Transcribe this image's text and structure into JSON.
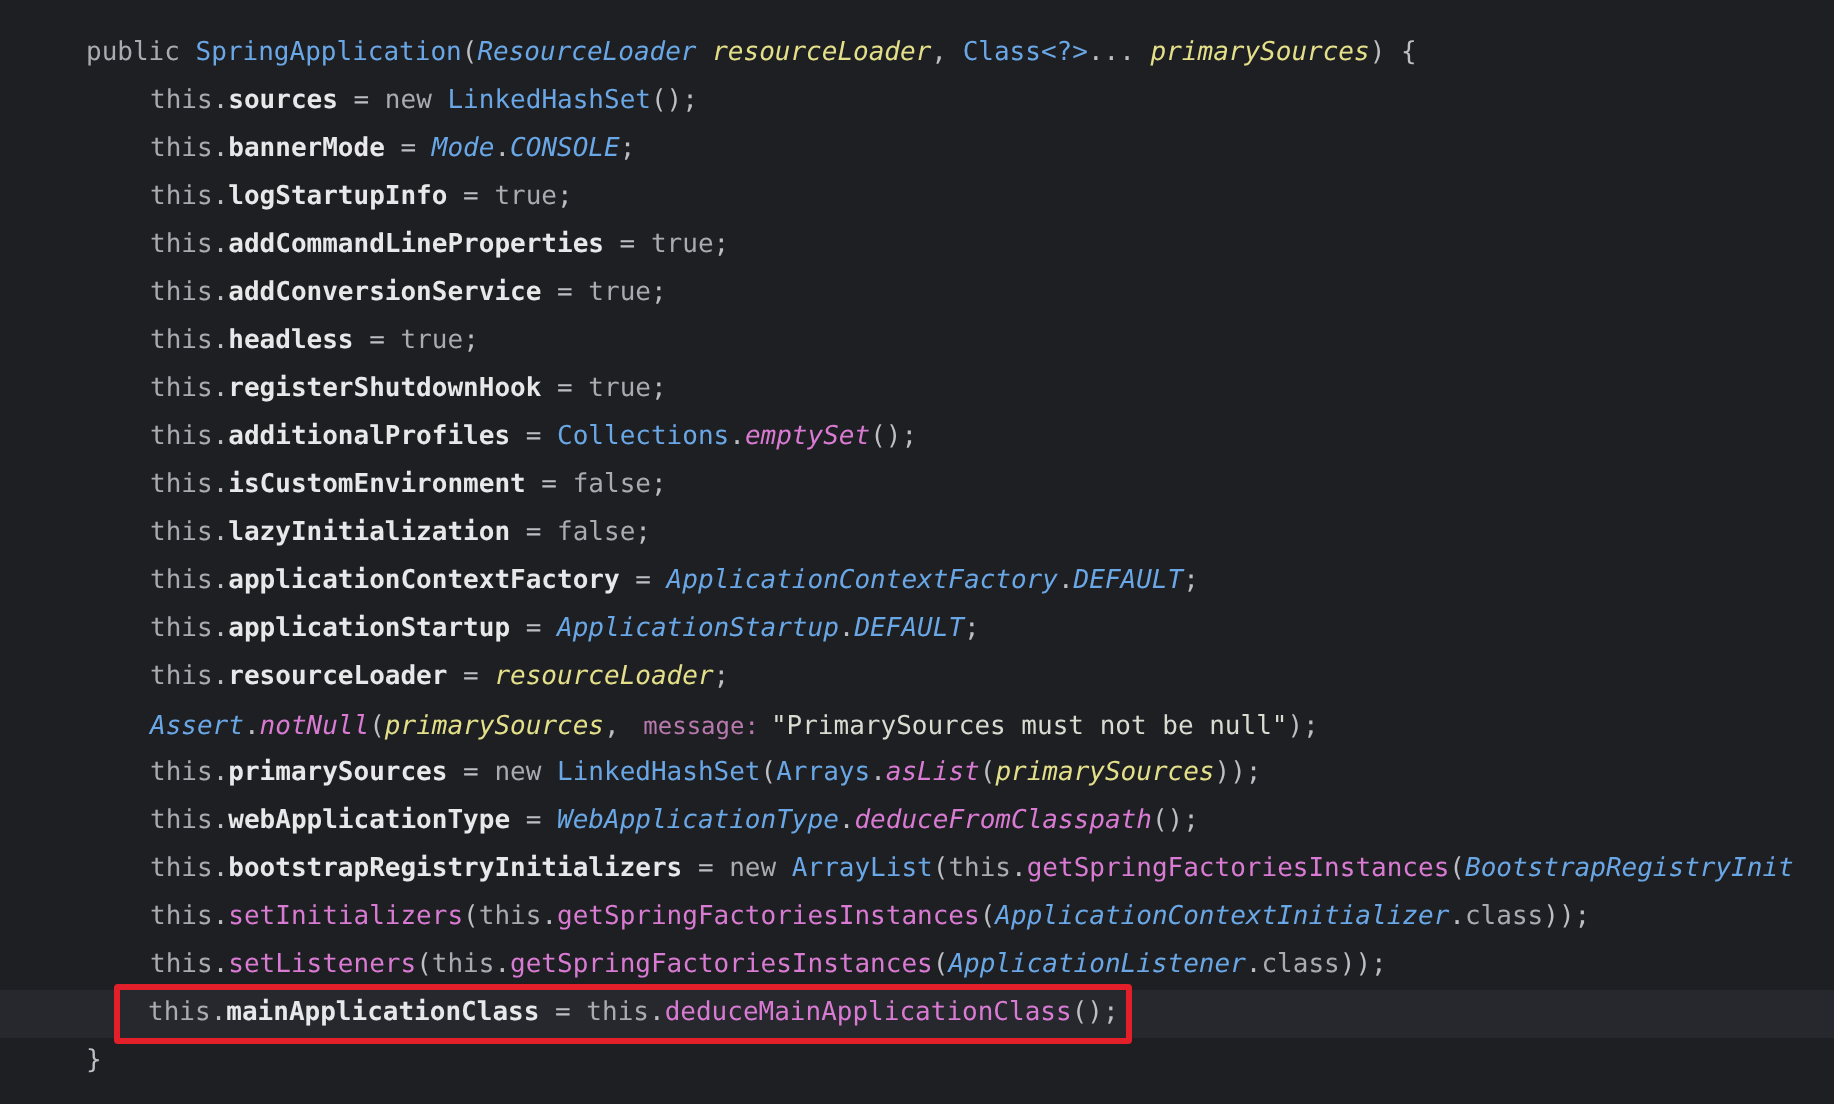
{
  "method": {
    "signature": [
      {
        "kind": "kw",
        "text": "public "
      },
      {
        "kind": "type",
        "text": "SpringApplication"
      },
      {
        "kind": "plain",
        "text": "("
      },
      {
        "kind": "itype",
        "text": "ResourceLoader "
      },
      {
        "kind": "param",
        "text": "resourceLoader"
      },
      {
        "kind": "plain",
        "text": ", "
      },
      {
        "kind": "type",
        "text": "Class<?>"
      },
      {
        "kind": "plain",
        "text": "... "
      },
      {
        "kind": "param",
        "text": "primarySources"
      },
      {
        "kind": "plain",
        "text": ") {"
      }
    ],
    "body": [
      {
        "current": false,
        "annotated": false,
        "tokens": [
          {
            "kind": "kw",
            "text": "this"
          },
          {
            "kind": "plain",
            "text": "."
          },
          {
            "kind": "field",
            "text": "sources"
          },
          {
            "kind": "plain",
            "text": " = "
          },
          {
            "kind": "kw",
            "text": "new "
          },
          {
            "kind": "type",
            "text": "LinkedHashSet"
          },
          {
            "kind": "plain",
            "text": "();"
          }
        ]
      },
      {
        "current": false,
        "annotated": false,
        "tokens": [
          {
            "kind": "kw",
            "text": "this"
          },
          {
            "kind": "plain",
            "text": "."
          },
          {
            "kind": "field",
            "text": "bannerMode"
          },
          {
            "kind": "plain",
            "text": " = "
          },
          {
            "kind": "itype",
            "text": "Mode"
          },
          {
            "kind": "plain",
            "text": "."
          },
          {
            "kind": "itype",
            "text": "CONSOLE"
          },
          {
            "kind": "plain",
            "text": ";"
          }
        ]
      },
      {
        "current": false,
        "annotated": false,
        "tokens": [
          {
            "kind": "kw",
            "text": "this"
          },
          {
            "kind": "plain",
            "text": "."
          },
          {
            "kind": "field",
            "text": "logStartupInfo"
          },
          {
            "kind": "plain",
            "text": " = "
          },
          {
            "kind": "kw",
            "text": "true"
          },
          {
            "kind": "plain",
            "text": ";"
          }
        ]
      },
      {
        "current": false,
        "annotated": false,
        "tokens": [
          {
            "kind": "kw",
            "text": "this"
          },
          {
            "kind": "plain",
            "text": "."
          },
          {
            "kind": "field",
            "text": "addCommandLineProperties"
          },
          {
            "kind": "plain",
            "text": " = "
          },
          {
            "kind": "kw",
            "text": "true"
          },
          {
            "kind": "plain",
            "text": ";"
          }
        ]
      },
      {
        "current": false,
        "annotated": false,
        "tokens": [
          {
            "kind": "kw",
            "text": "this"
          },
          {
            "kind": "plain",
            "text": "."
          },
          {
            "kind": "field",
            "text": "addConversionService"
          },
          {
            "kind": "plain",
            "text": " = "
          },
          {
            "kind": "kw",
            "text": "true"
          },
          {
            "kind": "plain",
            "text": ";"
          }
        ]
      },
      {
        "current": false,
        "annotated": false,
        "tokens": [
          {
            "kind": "kw",
            "text": "this"
          },
          {
            "kind": "plain",
            "text": "."
          },
          {
            "kind": "field",
            "text": "headless"
          },
          {
            "kind": "plain",
            "text": " = "
          },
          {
            "kind": "kw",
            "text": "true"
          },
          {
            "kind": "plain",
            "text": ";"
          }
        ]
      },
      {
        "current": false,
        "annotated": false,
        "tokens": [
          {
            "kind": "kw",
            "text": "this"
          },
          {
            "kind": "plain",
            "text": "."
          },
          {
            "kind": "field",
            "text": "registerShutdownHook"
          },
          {
            "kind": "plain",
            "text": " = "
          },
          {
            "kind": "kw",
            "text": "true"
          },
          {
            "kind": "plain",
            "text": ";"
          }
        ]
      },
      {
        "current": false,
        "annotated": false,
        "tokens": [
          {
            "kind": "kw",
            "text": "this"
          },
          {
            "kind": "plain",
            "text": "."
          },
          {
            "kind": "field",
            "text": "additionalProfiles"
          },
          {
            "kind": "plain",
            "text": " = "
          },
          {
            "kind": "type",
            "text": "Collections"
          },
          {
            "kind": "plain",
            "text": "."
          },
          {
            "kind": "imethod",
            "text": "emptySet"
          },
          {
            "kind": "plain",
            "text": "();"
          }
        ]
      },
      {
        "current": false,
        "annotated": false,
        "tokens": [
          {
            "kind": "kw",
            "text": "this"
          },
          {
            "kind": "plain",
            "text": "."
          },
          {
            "kind": "field",
            "text": "isCustomEnvironment"
          },
          {
            "kind": "plain",
            "text": " = "
          },
          {
            "kind": "kw",
            "text": "false"
          },
          {
            "kind": "plain",
            "text": ";"
          }
        ]
      },
      {
        "current": false,
        "annotated": false,
        "tokens": [
          {
            "kind": "kw",
            "text": "this"
          },
          {
            "kind": "plain",
            "text": "."
          },
          {
            "kind": "field",
            "text": "lazyInitialization"
          },
          {
            "kind": "plain",
            "text": " = "
          },
          {
            "kind": "kw",
            "text": "false"
          },
          {
            "kind": "plain",
            "text": ";"
          }
        ]
      },
      {
        "current": false,
        "annotated": false,
        "tokens": [
          {
            "kind": "kw",
            "text": "this"
          },
          {
            "kind": "plain",
            "text": "."
          },
          {
            "kind": "field",
            "text": "applicationContextFactory"
          },
          {
            "kind": "plain",
            "text": " = "
          },
          {
            "kind": "itype",
            "text": "ApplicationContextFactory"
          },
          {
            "kind": "plain",
            "text": "."
          },
          {
            "kind": "itype",
            "text": "DEFAULT"
          },
          {
            "kind": "plain",
            "text": ";"
          }
        ]
      },
      {
        "current": false,
        "annotated": false,
        "tokens": [
          {
            "kind": "kw",
            "text": "this"
          },
          {
            "kind": "plain",
            "text": "."
          },
          {
            "kind": "field",
            "text": "applicationStartup"
          },
          {
            "kind": "plain",
            "text": " = "
          },
          {
            "kind": "itype",
            "text": "ApplicationStartup"
          },
          {
            "kind": "plain",
            "text": "."
          },
          {
            "kind": "itype",
            "text": "DEFAULT"
          },
          {
            "kind": "plain",
            "text": ";"
          }
        ]
      },
      {
        "current": false,
        "annotated": false,
        "tokens": [
          {
            "kind": "kw",
            "text": "this"
          },
          {
            "kind": "plain",
            "text": "."
          },
          {
            "kind": "field",
            "text": "resourceLoader"
          },
          {
            "kind": "plain",
            "text": " = "
          },
          {
            "kind": "param",
            "text": "resourceLoader"
          },
          {
            "kind": "plain",
            "text": ";"
          }
        ]
      },
      {
        "current": false,
        "annotated": false,
        "tokens": [
          {
            "kind": "itype",
            "text": "Assert"
          },
          {
            "kind": "plain",
            "text": "."
          },
          {
            "kind": "imethod",
            "text": "notNull"
          },
          {
            "kind": "plain",
            "text": "("
          },
          {
            "kind": "param",
            "text": "primarySources"
          },
          {
            "kind": "plain",
            "text": ", "
          },
          {
            "kind": "hint",
            "text": "message:"
          },
          {
            "kind": "string",
            "text": "\"PrimarySources must not be null\""
          },
          {
            "kind": "plain",
            "text": ");"
          }
        ]
      },
      {
        "current": false,
        "annotated": false,
        "tokens": [
          {
            "kind": "kw",
            "text": "this"
          },
          {
            "kind": "plain",
            "text": "."
          },
          {
            "kind": "field",
            "text": "primarySources"
          },
          {
            "kind": "plain",
            "text": " = "
          },
          {
            "kind": "kw",
            "text": "new "
          },
          {
            "kind": "type",
            "text": "LinkedHashSet"
          },
          {
            "kind": "plain",
            "text": "("
          },
          {
            "kind": "type",
            "text": "Arrays"
          },
          {
            "kind": "plain",
            "text": "."
          },
          {
            "kind": "imethod",
            "text": "asList"
          },
          {
            "kind": "plain",
            "text": "("
          },
          {
            "kind": "param",
            "text": "primarySources"
          },
          {
            "kind": "plain",
            "text": "));"
          }
        ]
      },
      {
        "current": false,
        "annotated": false,
        "tokens": [
          {
            "kind": "kw",
            "text": "this"
          },
          {
            "kind": "plain",
            "text": "."
          },
          {
            "kind": "field",
            "text": "webApplicationType"
          },
          {
            "kind": "plain",
            "text": " = "
          },
          {
            "kind": "itype",
            "text": "WebApplicationType"
          },
          {
            "kind": "plain",
            "text": "."
          },
          {
            "kind": "imethod",
            "text": "deduceFromClasspath"
          },
          {
            "kind": "plain",
            "text": "();"
          }
        ]
      },
      {
        "current": false,
        "annotated": false,
        "tokens": [
          {
            "kind": "kw",
            "text": "this"
          },
          {
            "kind": "plain",
            "text": "."
          },
          {
            "kind": "field",
            "text": "bootstrapRegistryInitializers"
          },
          {
            "kind": "plain",
            "text": " = "
          },
          {
            "kind": "kw",
            "text": "new "
          },
          {
            "kind": "type",
            "text": "ArrayList"
          },
          {
            "kind": "plain",
            "text": "("
          },
          {
            "kind": "kw",
            "text": "this"
          },
          {
            "kind": "plain",
            "text": "."
          },
          {
            "kind": "method",
            "text": "getSpringFactoriesInstances"
          },
          {
            "kind": "plain",
            "text": "("
          },
          {
            "kind": "itype",
            "text": "BootstrapRegistryInit"
          }
        ]
      },
      {
        "current": false,
        "annotated": false,
        "tokens": [
          {
            "kind": "kw",
            "text": "this"
          },
          {
            "kind": "plain",
            "text": "."
          },
          {
            "kind": "method",
            "text": "setInitializers"
          },
          {
            "kind": "plain",
            "text": "("
          },
          {
            "kind": "kw",
            "text": "this"
          },
          {
            "kind": "plain",
            "text": "."
          },
          {
            "kind": "method",
            "text": "getSpringFactoriesInstances"
          },
          {
            "kind": "plain",
            "text": "("
          },
          {
            "kind": "itype",
            "text": "ApplicationContextInitializer"
          },
          {
            "kind": "plain",
            "text": "."
          },
          {
            "kind": "kw",
            "text": "class"
          },
          {
            "kind": "plain",
            "text": "));"
          }
        ]
      },
      {
        "current": false,
        "annotated": false,
        "tokens": [
          {
            "kind": "kw",
            "text": "this"
          },
          {
            "kind": "plain",
            "text": "."
          },
          {
            "kind": "method",
            "text": "setListeners"
          },
          {
            "kind": "plain",
            "text": "("
          },
          {
            "kind": "kw",
            "text": "this"
          },
          {
            "kind": "plain",
            "text": "."
          },
          {
            "kind": "method",
            "text": "getSpringFactoriesInstances"
          },
          {
            "kind": "plain",
            "text": "("
          },
          {
            "kind": "itype",
            "text": "ApplicationListener"
          },
          {
            "kind": "plain",
            "text": "."
          },
          {
            "kind": "kw",
            "text": "class"
          },
          {
            "kind": "plain",
            "text": "));"
          }
        ]
      },
      {
        "current": true,
        "annotated": true,
        "tokens": [
          {
            "kind": "kw",
            "text": "this"
          },
          {
            "kind": "plain",
            "text": "."
          },
          {
            "kind": "field",
            "text": "mainApplicationClass"
          },
          {
            "kind": "plain",
            "text": " = "
          },
          {
            "kind": "kw",
            "text": "this"
          },
          {
            "kind": "plain",
            "text": "."
          },
          {
            "kind": "method",
            "text": "deduceMainApplicationClass"
          },
          {
            "kind": "plain",
            "text": "();"
          }
        ]
      }
    ],
    "closing": "}"
  }
}
